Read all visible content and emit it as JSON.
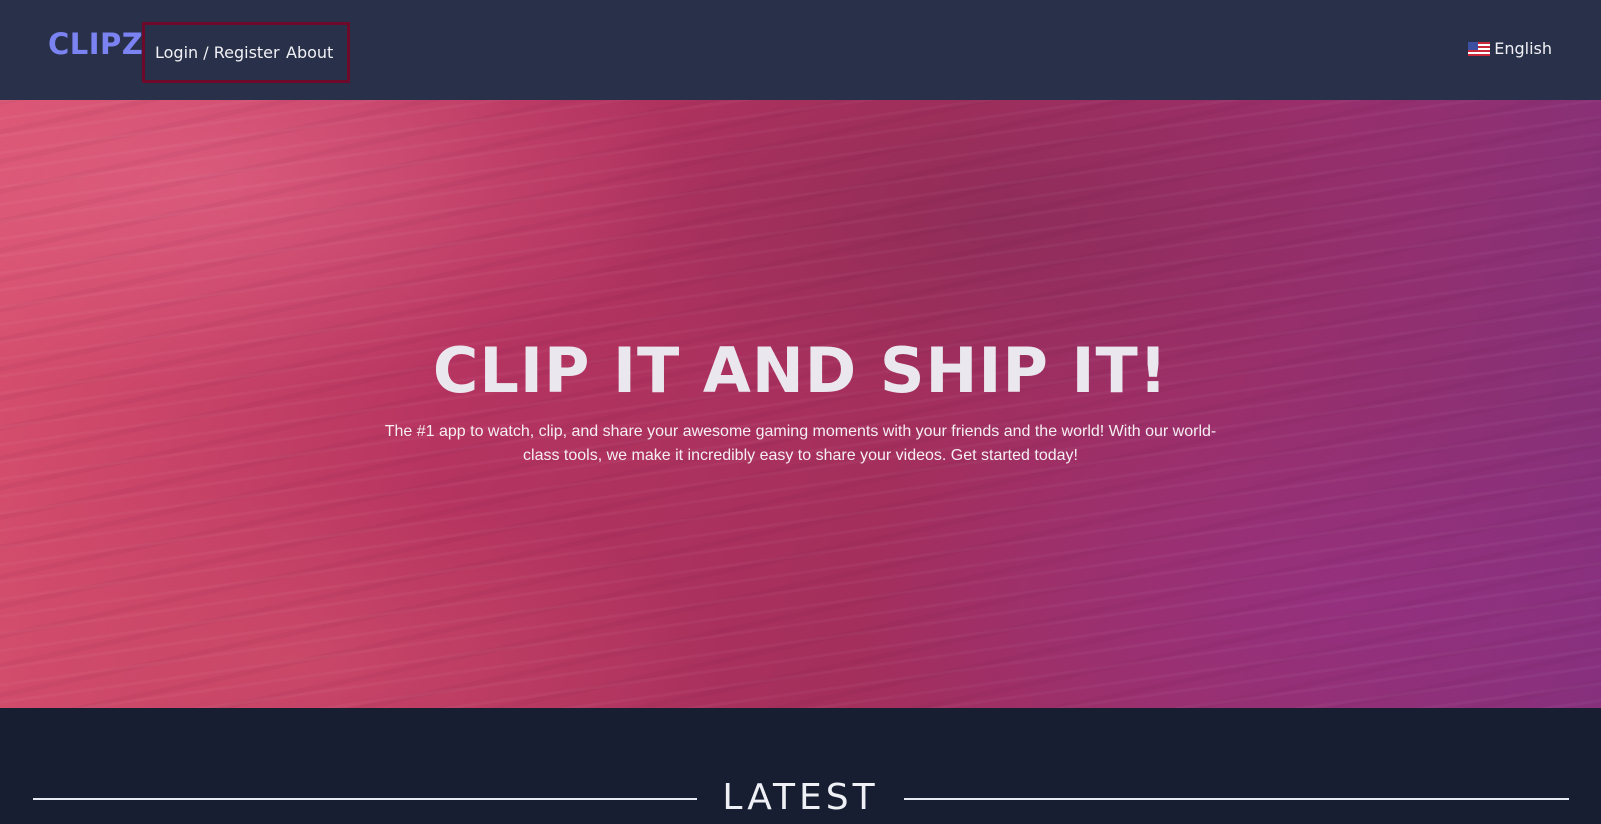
{
  "navbar": {
    "logo": "CLIPZ",
    "links": {
      "login": "Login / Register",
      "about": "About"
    },
    "language": {
      "label": "English",
      "flag_icon": "us-flag-icon"
    }
  },
  "hero": {
    "title": "CLIP IT AND SHIP IT!",
    "subtitle": "The #1 app to watch, clip, and share your awesome gaming moments with your friends and the world! With our world-class tools, we make it incredibly easy to share your videos. Get started today!"
  },
  "latest": {
    "title": "LATEST"
  },
  "colors": {
    "navbar_bg": "#283149",
    "logo": "#7b82f1",
    "highlight_border": "#6d0a2a",
    "page_bg": "#171e31",
    "hero_accent": "#b53460"
  }
}
